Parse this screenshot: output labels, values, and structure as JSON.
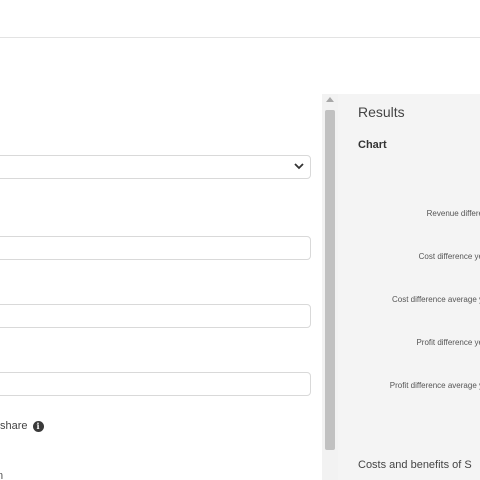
{
  "results": {
    "title": "Results",
    "chart_heading": "Chart",
    "costs_heading": "Costs and benefits of S"
  },
  "chart": {
    "labels": [
      "Revenue differe",
      "Cost difference ye",
      "Cost difference average y",
      "Profit difference ye",
      "Profit difference average y"
    ]
  },
  "form": {
    "share_label": "share",
    "partial_text": "n"
  },
  "icons": {
    "dropdown": "chevron-down-icon",
    "info": "info-icon"
  }
}
